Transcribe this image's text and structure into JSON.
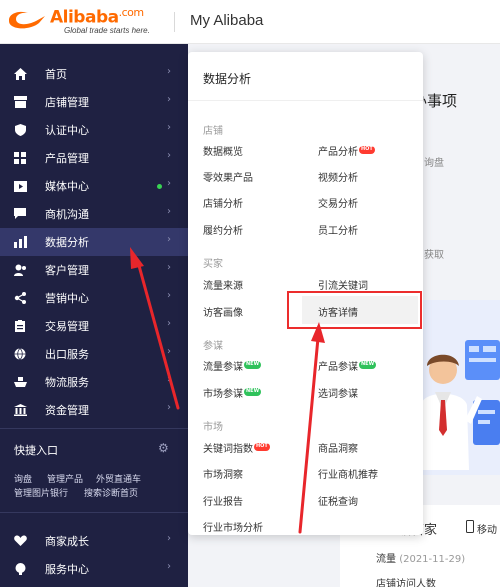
{
  "header": {
    "logo_text": "Alibaba",
    "logo_suffix": ".com",
    "logo_tagline": "Global trade starts here.",
    "title": "My Alibaba"
  },
  "sidebar": {
    "items": [
      {
        "label": "首页",
        "icon": "home-icon"
      },
      {
        "label": "店铺管理",
        "icon": "store-icon"
      },
      {
        "label": "认证中心",
        "icon": "shield-icon"
      },
      {
        "label": "产品管理",
        "icon": "grid-icon"
      },
      {
        "label": "媒体中心",
        "icon": "media-icon"
      },
      {
        "label": "商机沟通",
        "icon": "chat-icon"
      },
      {
        "label": "数据分析",
        "icon": "bar-chart-icon"
      },
      {
        "label": "客户管理",
        "icon": "users-icon"
      },
      {
        "label": "营销中心",
        "icon": "share-icon"
      },
      {
        "label": "交易管理",
        "icon": "clipboard-icon"
      },
      {
        "label": "出口服务",
        "icon": "globe-icon"
      },
      {
        "label": "物流服务",
        "icon": "ship-icon"
      },
      {
        "label": "资金管理",
        "icon": "bank-icon"
      }
    ],
    "active_item": "数据分析",
    "shortcuts_title": "快捷入口",
    "shortcuts": [
      "询盘",
      "管理产品",
      "外贸直通车",
      "管理图片银行",
      "搜索诊断首页"
    ],
    "bottom_items": [
      {
        "label": "商家成长",
        "icon": "heart-icon"
      },
      {
        "label": "服务中心",
        "icon": "service-icon"
      }
    ],
    "colors": {
      "background": "#1f2142",
      "active": "#34386a",
      "dot": "#39d353"
    }
  },
  "dropdown": {
    "title": "数据分析",
    "sections": [
      {
        "name": "店铺",
        "items": [
          "数据概览",
          "产品分析",
          "零效果产品",
          "视频分析",
          "店铺分析",
          "交易分析",
          "履约分析",
          "员工分析"
        ]
      },
      {
        "name": "买家",
        "items": [
          "流量来源",
          "引流关键词",
          "访客画像",
          "访客详情"
        ]
      },
      {
        "name": "参谋",
        "items": [
          "流量参谋",
          "产品参谋",
          "市场参谋",
          "选词参谋"
        ]
      },
      {
        "name": "市场",
        "items": [
          "关键词指数",
          "商品洞察",
          "市场洞察",
          "行业商机推荐",
          "行业报告",
          "征税查询",
          "行业市场分析"
        ]
      }
    ],
    "badges": {
      "hot": "HOT",
      "new": "NEW"
    },
    "highlighted_item": "访客详情",
    "colors": {
      "highlight_border": "#ec2d2d",
      "hot_badge": "#ff3b30",
      "new_badge": "#2fc25b"
    }
  },
  "background_page": {
    "todo_title": "办事项",
    "side_text_1": "询盘",
    "side_text_2": "获取",
    "card_title": "据管家",
    "card_sub": "移动",
    "traffic_label": "流量",
    "traffic_date": "(2021-11-29)",
    "visitors_label": "店铺访问人数"
  }
}
